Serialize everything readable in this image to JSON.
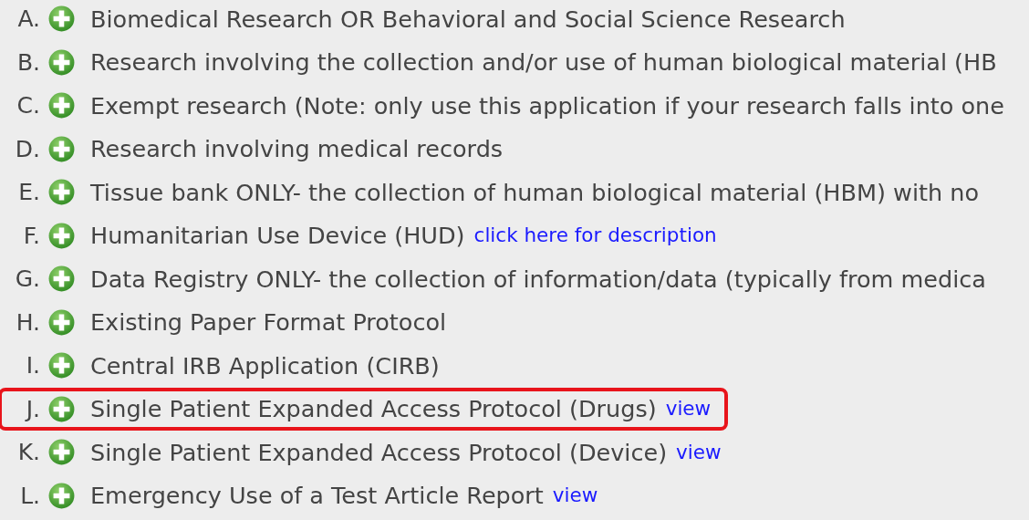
{
  "options": [
    {
      "letter": "A.",
      "label": "Biomedical Research OR Behavioral and Social Science Research",
      "highlighted": false
    },
    {
      "letter": "B.",
      "label": "Research involving the collection and/or use of human biological material (HB",
      "highlighted": false
    },
    {
      "letter": "C.",
      "label": "Exempt research (Note: only use this application if your research falls into one",
      "highlighted": false
    },
    {
      "letter": "D.",
      "label": "Research involving medical records",
      "highlighted": false
    },
    {
      "letter": "E.",
      "label": "Tissue bank ONLY- the collection of human biological material (HBM) with no",
      "highlighted": false
    },
    {
      "letter": "F.",
      "label": "Humanitarian Use Device (HUD)",
      "link": "click here for description",
      "highlighted": false
    },
    {
      "letter": "G.",
      "label": "Data Registry ONLY- the collection of information/data (typically from medica",
      "highlighted": false
    },
    {
      "letter": "H.",
      "label": "Existing Paper Format Protocol",
      "highlighted": false
    },
    {
      "letter": "I.",
      "label": "Central IRB Application (CIRB)",
      "highlighted": false
    },
    {
      "letter": "J.",
      "label": "Single Patient Expanded Access Protocol (Drugs)",
      "link": "view",
      "highlighted": true
    },
    {
      "letter": "K.",
      "label": "Single Patient Expanded Access Protocol (Device)",
      "link": "view",
      "highlighted": false
    },
    {
      "letter": "L.",
      "label": "Emergency Use of a Test Article Report",
      "link": "view",
      "highlighted": false
    }
  ]
}
